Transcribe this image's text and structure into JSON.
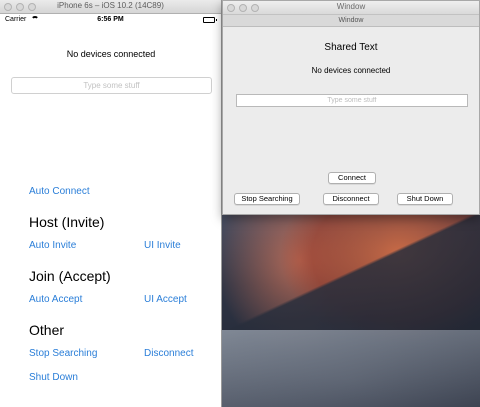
{
  "simulator": {
    "window_title": "iPhone 6s – iOS 10.2 (14C89)",
    "status_bar": {
      "carrier": "Carrier",
      "time": "6:56 PM"
    },
    "connection_status": "No devices connected",
    "input_placeholder": "Type some stuff",
    "auto_connect_label": "Auto Connect",
    "host_heading": "Host (Invite)",
    "auto_invite_label": "Auto Invite",
    "ui_invite_label": "UI Invite",
    "join_heading": "Join (Accept)",
    "auto_accept_label": "Auto Accept",
    "ui_accept_label": "UI Accept",
    "other_heading": "Other",
    "stop_searching_label": "Stop Searching",
    "disconnect_label": "Disconnect",
    "shut_down_label": "Shut Down"
  },
  "mac_window": {
    "window_title": "Window",
    "tab_label": "Window",
    "heading": "Shared Text",
    "connection_status": "No devices connected",
    "input_placeholder": "Type some stuff",
    "connect_label": "Connect",
    "stop_searching_label": "Stop Searching",
    "disconnect_label": "Disconnect",
    "shut_down_label": "Shut Down"
  },
  "colors": {
    "ios_link": "#2a7ed8",
    "battery": "#4cd964"
  }
}
